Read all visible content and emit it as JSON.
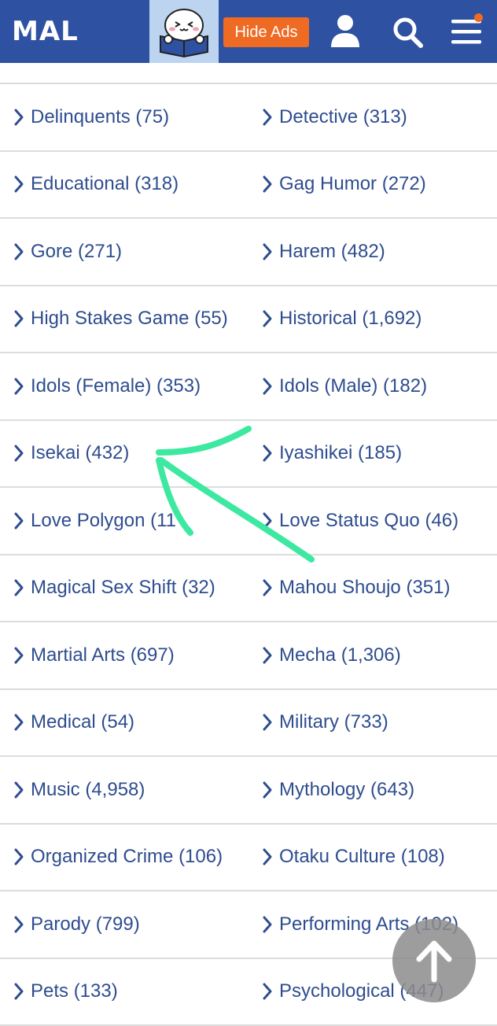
{
  "header": {
    "logo": "MAL",
    "mascot_icon": "reading-mascot-icon",
    "hide_ads_label": "Hide Ads",
    "user_icon": "user-icon",
    "search_icon": "search-icon",
    "menu_icon": "hamburger-menu-icon",
    "brand_color": "#2e51a2",
    "accent_color": "#ef6a22"
  },
  "genres": [
    [
      "Delinquents (75)",
      "Detective (313)"
    ],
    [
      "Educational (318)",
      "Gag Humor (272)"
    ],
    [
      "Gore (271)",
      "Harem (482)"
    ],
    [
      "High Stakes Game (55)",
      "Historical (1,692)"
    ],
    [
      "Idols (Female) (353)",
      "Idols (Male) (182)"
    ],
    [
      "Isekai (432)",
      "Iyashikei (185)"
    ],
    [
      "Love Polygon (11",
      "Love Status Quo (46)"
    ],
    [
      "Magical Sex Shift (32)",
      "Mahou Shoujo (351)"
    ],
    [
      "Martial Arts (697)",
      "Mecha (1,306)"
    ],
    [
      "Medical (54)",
      "Military (733)"
    ],
    [
      "Music (4,958)",
      "Mythology (643)"
    ],
    [
      "Organized Crime (106)",
      "Otaku Culture (108)"
    ],
    [
      "Parody (799)",
      "Performing Arts (102)"
    ],
    [
      "Pets (133)",
      "Psychological (447)"
    ]
  ],
  "annotation": {
    "icon": "green-arrow-annotation",
    "color": "#3de8a0"
  },
  "scroll_top_icon": "arrow-up-icon"
}
